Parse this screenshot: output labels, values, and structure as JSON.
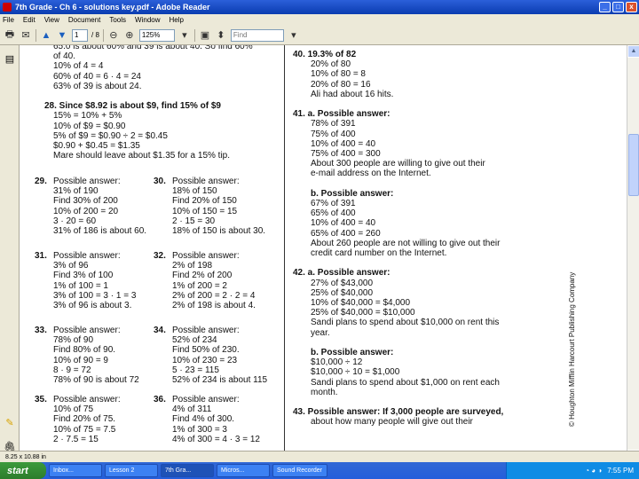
{
  "window": {
    "title": "7th Grade - Ch 6 - solutions key.pdf - Adobe Reader",
    "min": "_",
    "max": "□",
    "close": "x"
  },
  "menu": [
    "File",
    "Edit",
    "View",
    "Document",
    "Tools",
    "Window",
    "Help"
  ],
  "toolbar": {
    "page": "1",
    "page_total": "/ 8",
    "zoom": "125%",
    "find_placeholder": "Find"
  },
  "status": {
    "page_size": "8.25 x 10.88 in"
  },
  "taskbar": {
    "start": "start",
    "tasks": [
      "Inbox...",
      "Lesson 2",
      "7th Gra...",
      "Micros...",
      "Sound Recorder"
    ],
    "time": "7:55 PM"
  },
  "copyright": "© Houghton Mifflin Harcourt Publishing Company",
  "left_column": [
    {
      "t": "65.0 is about 60% and 39 is about 40. So find 60%",
      "b": false
    },
    {
      "t": "of 40.",
      "b": false
    },
    {
      "t": "10% of 4 = 4",
      "b": false
    },
    {
      "t": "60% of 40 = 6 · 4 = 24",
      "b": false
    },
    {
      "t": "63% of 39 is about 24.",
      "b": false
    },
    {
      "t": "",
      "b": false
    },
    {
      "t": "28.  Since $8.92 is about $9, find 15% of $9",
      "b": true
    },
    {
      "t": "15% = 10% + 5%",
      "b": false
    },
    {
      "t": "10% of $9 = $0.90",
      "b": false
    },
    {
      "t": "5% of $9 = $0.90 ÷ 2 = $0.45",
      "b": false
    },
    {
      "t": "$0.90 + $0.45 = $1.35",
      "b": false
    },
    {
      "t": "Mare should leave about $1.35 for a 15% tip.",
      "b": false
    }
  ],
  "pairs": [
    {
      "ln": "29.",
      "ll": [
        "Possible answer:",
        "31% of 190",
        "Find 30% of 200",
        "10% of 200 = 20",
        "3 · 20 = 60",
        "31% of 186 is about 60."
      ],
      "rn": "30.",
      "rl": [
        "Possible answer:",
        "18% of 150",
        "Find 20% of 150",
        "10% of 150 = 15",
        "2 · 15 = 30",
        "18% of 150 is about 30."
      ]
    },
    {
      "ln": "31.",
      "ll": [
        "Possible answer:",
        "3% of 96",
        "Find 3% of 100",
        "1% of 100 = 1",
        "3% of 100 = 3 · 1 = 3",
        "3% of 96 is about 3."
      ],
      "rn": "32.",
      "rl": [
        "Possible answer:",
        "2% of 198",
        "Find 2% of 200",
        "1% of 200 = 2",
        "2% of 200 = 2 · 2 = 4",
        "2% of 198 is about 4."
      ]
    },
    {
      "ln": "33.",
      "ll": [
        "Possible answer:",
        "78% of 90",
        "Find 80% of 90.",
        "10% of 90 = 9",
        "8 · 9 = 72",
        "78% of 90 is about 72"
      ],
      "rn": "34.",
      "rl": [
        "Possible answer:",
        "52% of 234",
        "Find 50% of 230.",
        "10% of 230 = 23",
        "5 · 23 = 115",
        "52% of 234 is about 115"
      ]
    },
    {
      "ln": "35.",
      "ll": [
        "Possible answer:",
        "10% of 75",
        "Find 20% of 75.",
        "10% of 75 = 7.5",
        "2 · 7.5 = 15"
      ],
      "rn": "36.",
      "rl": [
        "Possible answer:",
        "4% of 311",
        "Find 4% of 300.",
        "1% of 300 = 3",
        "4% of 300 = 4 · 3 = 12"
      ]
    }
  ],
  "right_column": [
    {
      "t": "40.  19.3% of 82",
      "b": true
    },
    {
      "t": "20% of 80",
      "b": false
    },
    {
      "t": "10% of 80 = 8",
      "b": false
    },
    {
      "t": "20% of 80 = 16",
      "b": false
    },
    {
      "t": "Ali had about 16 hits.",
      "b": false
    },
    {
      "t": "",
      "b": false
    },
    {
      "t": "41. a.  Possible answer:",
      "b": true
    },
    {
      "t": "78% of 391",
      "b": false
    },
    {
      "t": "75% of 400",
      "b": false
    },
    {
      "t": "10% of 400 = 40",
      "b": false
    },
    {
      "t": "75% of 400 = 300",
      "b": false
    },
    {
      "t": "About 300 people are willing to give out their",
      "b": false
    },
    {
      "t": "e-mail address on the Internet.",
      "b": false
    },
    {
      "t": "",
      "b": false
    },
    {
      "t": "b.  Possible answer:",
      "b": true
    },
    {
      "t": "67% of 391",
      "b": false
    },
    {
      "t": "65% of 400",
      "b": false
    },
    {
      "t": "10% of 400 = 40",
      "b": false
    },
    {
      "t": "65% of 400 = 260",
      "b": false
    },
    {
      "t": "About 260 people are not willing to give out their",
      "b": false
    },
    {
      "t": "credit card number on the Internet.",
      "b": false
    },
    {
      "t": "",
      "b": false
    },
    {
      "t": "42. a.  Possible answer:",
      "b": true
    },
    {
      "t": "27% of $43,000",
      "b": false
    },
    {
      "t": "25% of $40,000",
      "b": false
    },
    {
      "t": "10% of $40,000 = $4,000",
      "b": false
    },
    {
      "t": "25% of $40,000 = $10,000",
      "b": false
    },
    {
      "t": "Sandi plans to spend about $10,000 on rent this",
      "b": false
    },
    {
      "t": "year.",
      "b": false
    },
    {
      "t": "",
      "b": false
    },
    {
      "t": "b.  Possible answer:",
      "b": true
    },
    {
      "t": "$10,000 ÷ 12",
      "b": false
    },
    {
      "t": "$10,000 ÷ 10 = $1,000",
      "b": false
    },
    {
      "t": "Sandi plans to spend about $1,000 on rent each",
      "b": false
    },
    {
      "t": "month.",
      "b": false
    },
    {
      "t": "",
      "b": false
    },
    {
      "t": "43.  Possible answer: If 3,000 people are surveyed,",
      "b": true
    },
    {
      "t": "about how many people will give out their",
      "b": false
    }
  ]
}
